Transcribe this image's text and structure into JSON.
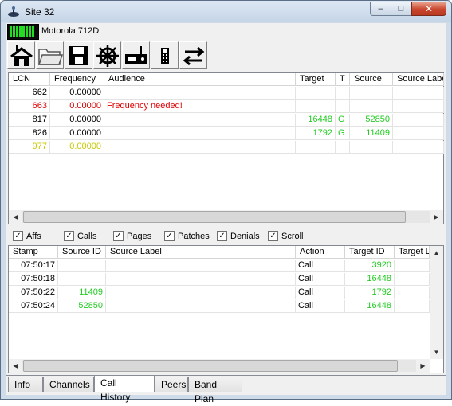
{
  "window": {
    "title": "Site 32",
    "min_glyph": "–",
    "max_glyph": "□",
    "close_glyph": "✕"
  },
  "radio": {
    "name": "Motorola 712D",
    "signal_bars": 8
  },
  "toolbar": {
    "buttons": [
      {
        "icon": "home-site-icon"
      },
      {
        "icon": "open-folder-icon"
      },
      {
        "icon": "save-disk-icon"
      },
      {
        "icon": "helm-wheel-icon"
      },
      {
        "icon": "radio-device-icon"
      },
      {
        "icon": "scanner-handheld-icon"
      },
      {
        "icon": "swap-arrows-icon"
      }
    ]
  },
  "channels": {
    "columns": [
      "LCN",
      "Frequency",
      "Audience",
      "Target",
      "T",
      "Source",
      "Source Label"
    ],
    "rows": [
      {
        "lcn": "662",
        "freq": "0.00000",
        "audience": "",
        "target": "",
        "t": "",
        "source": "",
        "color": "#000000"
      },
      {
        "lcn": "663",
        "freq": "0.00000",
        "audience": "Frequency needed!",
        "target": "",
        "t": "",
        "source": "",
        "color": "#dd0000"
      },
      {
        "lcn": "817",
        "freq": "0.00000",
        "audience": "",
        "target": "16448",
        "t": "G",
        "source": "52850",
        "color": "#000000"
      },
      {
        "lcn": "826",
        "freq": "0.00000",
        "audience": "",
        "target": "1792",
        "t": "G",
        "source": "11409",
        "color": "#000000"
      },
      {
        "lcn": "977",
        "freq": "0.00000",
        "audience": "",
        "target": "",
        "t": "",
        "source": "",
        "color": "#c8c800"
      }
    ]
  },
  "filters": [
    {
      "label": "Affs",
      "checked": true
    },
    {
      "label": "Calls",
      "checked": true
    },
    {
      "label": "Pages",
      "checked": true
    },
    {
      "label": "Patches",
      "checked": true
    },
    {
      "label": "Denials",
      "checked": true
    },
    {
      "label": "Scroll",
      "checked": true
    }
  ],
  "history": {
    "columns": [
      "Stamp",
      "Source ID",
      "Source Label",
      "Action",
      "Target ID",
      "Target Label"
    ],
    "rows": [
      {
        "stamp": "07:50:17",
        "source_id": "",
        "action": "Call",
        "target_id": "3920"
      },
      {
        "stamp": "07:50:18",
        "source_id": "",
        "action": "Call",
        "target_id": "16448"
      },
      {
        "stamp": "07:50:22",
        "source_id": "11409",
        "action": "Call",
        "target_id": "1792"
      },
      {
        "stamp": "07:50:24",
        "source_id": "52850",
        "action": "Call",
        "target_id": "16448"
      }
    ]
  },
  "tabs": [
    {
      "label": "Info",
      "active": false
    },
    {
      "label": "Channels",
      "active": false
    },
    {
      "label": "Call History",
      "active": true
    },
    {
      "label": "Peers",
      "active": false
    },
    {
      "label": "Band Plan",
      "active": false
    }
  ],
  "colors": {
    "id_green": "#22cc22",
    "warning_red": "#dd0000",
    "idle_yellow": "#c8c800"
  }
}
